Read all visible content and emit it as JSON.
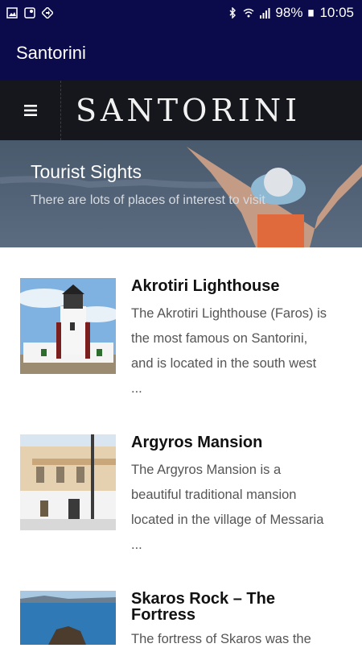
{
  "status_bar": {
    "battery": "98%",
    "time": "10:05",
    "icons_left": [
      "gallery-icon",
      "maps-icon",
      "navigation-icon"
    ],
    "icons_right": [
      "bluetooth-icon",
      "wifi-icon",
      "signal-icon",
      "battery-icon"
    ]
  },
  "app_bar": {
    "title": "Santorini"
  },
  "site_header": {
    "logo_text": "SANTORINI",
    "menu_icon": "hamburger-icon"
  },
  "hero": {
    "title": "Tourist Sights",
    "subtitle": "There are lots of places of interest to visit"
  },
  "sights": [
    {
      "title": "Akrotiri Lighthouse",
      "excerpt": "The Akrotiri Lighthouse (Faros) is\nthe most famous on Santorini,\nand is located in the south west\n..."
    },
    {
      "title": "Argyros Mansion",
      "excerpt": "The Argyros Mansion is a\nbeautiful traditional mansion\nlocated in the village of Messaria\n..."
    },
    {
      "title": "Skaros Rock – The\nFortress",
      "excerpt": "The fortress of Skaros was the"
    }
  ]
}
